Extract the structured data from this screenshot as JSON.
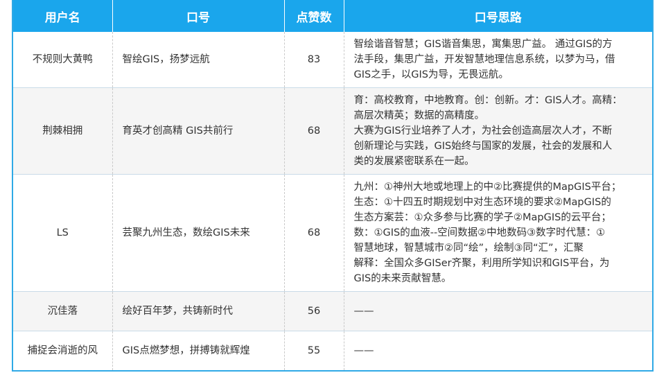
{
  "table": {
    "headers": [
      "用户名",
      "口号",
      "点赞数",
      "口号思路"
    ],
    "rows": [
      {
        "user": "不规则大黄鸭",
        "slogan": "智绘GIS，扬梦远航",
        "likes": "83",
        "idea": [
          "智绘谐音智慧；GIS谐音集思，寓集思广益。 通过GIS的方",
          "法手段，集思广益，开发智慧地理信息系统，以梦为马，借",
          "GIS之手，以GIS为导，无畏远航。"
        ]
      },
      {
        "user": "荆棘相拥",
        "slogan": "育英才创高精 GIS共前行",
        "likes": "68",
        "idea": [
          "育：高校教育，中地教育。创：创新。才：GIS人才。高精：",
          "高层次精英；数据的高精度。",
          "大赛为GIS行业培养了人才，为社会创造高层次人才，不断",
          "创新理论与实践，GIS始终与国家的发展，社会的发展和人",
          "类的发展紧密联系在一起。"
        ]
      },
      {
        "user": "LS",
        "slogan": "芸聚九州生态，数绘GIS未来",
        "likes": "68",
        "idea": [
          "九州：①神州大地或地理上的中②比赛提供的MapGIS平台；",
          "生态：①十四五时期规划中对生态环境的要求②MapGIS的",
          "生态方案芸：①众多参与比赛的学子②MapGIS的云平台；",
          "数：①GIS的血液--空间数据②中地数码③数字时代慧：①",
          "智慧地球，智慧城市②同“绘”，绘制③同“汇”，汇聚",
          "解释：全国众多GISer齐聚，利用所学知识和GIS平台，为",
          "GIS的未来贡献智慧。"
        ]
      },
      {
        "user": "沉佳落",
        "slogan": "绘好百年梦，共铸新时代",
        "likes": "56",
        "idea": [
          "——"
        ]
      },
      {
        "user": "捕捉会消逝的风",
        "slogan": "GIS点燃梦想，拼搏铸就辉煌",
        "likes": "55",
        "idea": [
          "——"
        ]
      }
    ]
  }
}
